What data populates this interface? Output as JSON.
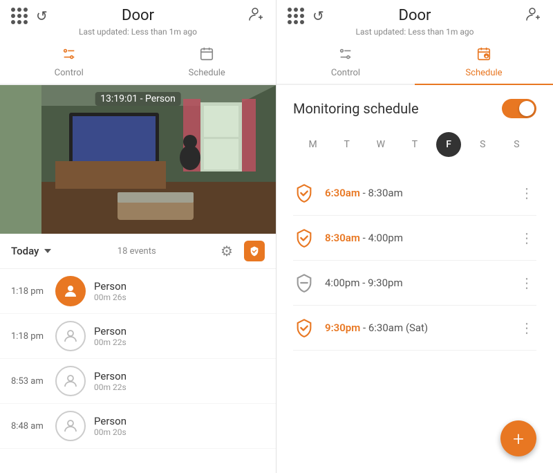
{
  "left": {
    "title": "Door",
    "last_updated": "Last updated: Less than 1m ago",
    "tabs": [
      {
        "label": "Control",
        "active": false
      },
      {
        "label": "Schedule",
        "active": false
      }
    ],
    "camera": {
      "overlay": "13:19:01 - Person"
    },
    "events": {
      "today_label": "Today",
      "count": "18 events",
      "items": [
        {
          "time": "1:18 pm",
          "label": "Person",
          "duration": "00m 26s",
          "style": "orange"
        },
        {
          "time": "1:18 pm",
          "label": "Person",
          "duration": "00m 22s",
          "style": "outline"
        },
        {
          "time": "8:53 am",
          "label": "Person",
          "duration": "00m 22s",
          "style": "outline"
        },
        {
          "time": "8:48 am",
          "label": "Person",
          "duration": "00m 20s",
          "style": "outline"
        }
      ]
    }
  },
  "right": {
    "title": "Door",
    "last_updated": "Last updated: Less than 1m ago",
    "tabs": [
      {
        "label": "Control",
        "active": false
      },
      {
        "label": "Schedule",
        "active": true
      }
    ],
    "schedule": {
      "title": "Monitoring schedule",
      "toggle_on": true,
      "days": [
        {
          "label": "M",
          "active": false
        },
        {
          "label": "T",
          "active": false
        },
        {
          "label": "W",
          "active": false
        },
        {
          "label": "T",
          "active": false
        },
        {
          "label": "F",
          "active": true
        },
        {
          "label": "S",
          "active": false
        },
        {
          "label": "S",
          "active": false
        }
      ],
      "items": [
        {
          "start": "6:30am",
          "end": "8:30am",
          "icon": "shield-check"
        },
        {
          "start": "8:30am",
          "end": "4:00pm",
          "icon": "shield-check"
        },
        {
          "start": "4:00pm",
          "end": "9:30pm",
          "icon": "shield-minus"
        },
        {
          "start": "9:30pm",
          "end": "6:30am (Sat)",
          "icon": "shield-check"
        }
      ]
    },
    "fab": "+"
  }
}
